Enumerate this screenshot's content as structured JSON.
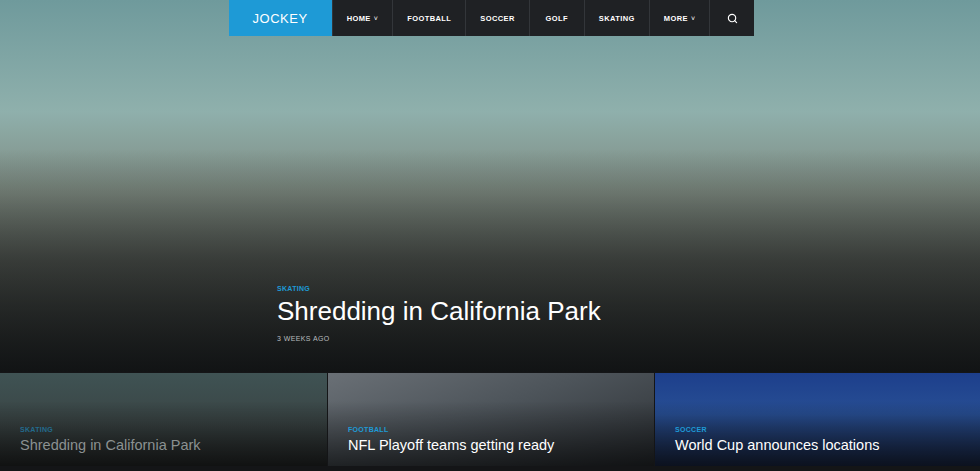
{
  "logo": "JOCKEY",
  "nav": [
    {
      "label": "HOME",
      "dropdown": true,
      "selected": false
    },
    {
      "label": "FOOTBALL",
      "dropdown": false,
      "selected": false
    },
    {
      "label": "SOCCER",
      "dropdown": false,
      "selected": false
    },
    {
      "label": "GOLF",
      "dropdown": false,
      "selected": false
    },
    {
      "label": "SKATING",
      "dropdown": false,
      "selected": false
    },
    {
      "label": "MORE",
      "dropdown": true,
      "selected": false
    }
  ],
  "dropdown_glyph": "˅",
  "featured": {
    "category": "SKATING",
    "title": "Shredding in California Park",
    "time": "3 WEEKS AGO"
  },
  "cards": [
    {
      "category": "SKATING",
      "title": "Shredding in California Park",
      "selected": true
    },
    {
      "category": "FOOTBALL",
      "title": "NFL Playoff teams getting ready",
      "selected": false
    },
    {
      "category": "SOCCER",
      "title": "World Cup announces locations",
      "selected": false
    }
  ]
}
